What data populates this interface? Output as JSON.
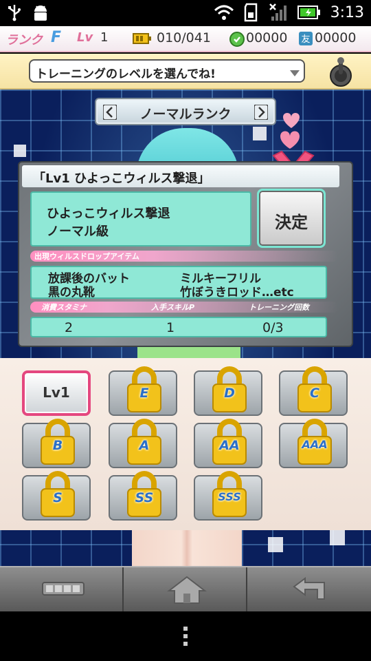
{
  "status_bar": {
    "time": "3:13"
  },
  "hud": {
    "rank_label": "ランク",
    "rank_value": "F",
    "lv_label": "Lv",
    "lv_value": "1",
    "stamina": "010/041",
    "coins": "00000",
    "friend_points": "00000"
  },
  "message": {
    "text": "トレーニングのレベルを選んでね!"
  },
  "rank_selector": {
    "label": "ノーマルランク"
  },
  "quest": {
    "title": "「Lv1 ひよっこウィルス撃退」",
    "name": "ひよっこウィルス撃退",
    "difficulty": "ノーマル級",
    "confirm_label": "決定",
    "drop_header": "出現ウィルスドロップアイテム",
    "drops": [
      "放課後のバット",
      "ミルキーフリル",
      "黒の丸靴",
      "竹ぼうきロッド…etc"
    ],
    "stats_headers": [
      "消費スタミナ",
      "入手スキルP",
      "トレーニング回数"
    ],
    "stamina_cost": "2",
    "skill_points": "1",
    "training_count": "0/3"
  },
  "levels": [
    {
      "label": "Lv1",
      "locked": false,
      "selected": true
    },
    {
      "label": "E",
      "locked": true
    },
    {
      "label": "D",
      "locked": true
    },
    {
      "label": "C",
      "locked": true
    },
    {
      "label": "B",
      "locked": true
    },
    {
      "label": "A",
      "locked": true
    },
    {
      "label": "AA",
      "locked": true
    },
    {
      "label": "AAA",
      "locked": true
    },
    {
      "label": "S",
      "locked": true
    },
    {
      "label": "SS",
      "locked": true
    },
    {
      "label": "SSS",
      "locked": true
    }
  ],
  "nav": {
    "icons": [
      "menu-grid-icon",
      "home-icon",
      "back-icon"
    ]
  },
  "colors": {
    "accent_pink": "#e4477f",
    "panel_teal": "#8fe8d6",
    "lock_gold": "#f2c21b"
  }
}
